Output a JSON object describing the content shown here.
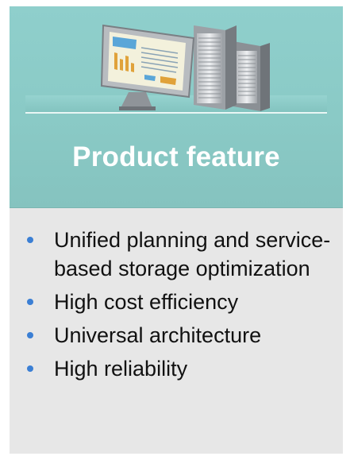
{
  "title": "Product feature",
  "features": [
    "Unified planning and service-based storage optimization",
    "High cost efficiency",
    "Universal architecture",
    "High reliability"
  ],
  "icons": {
    "header_illustration": "computer-monitor-and-server-racks",
    "bullet": "circle-bullet"
  },
  "colors": {
    "header_background": "#8acac6",
    "title_text": "#ffffff",
    "body_background": "#e7e7e7",
    "bullet": "#3b7fd4",
    "body_text": "#111111"
  }
}
